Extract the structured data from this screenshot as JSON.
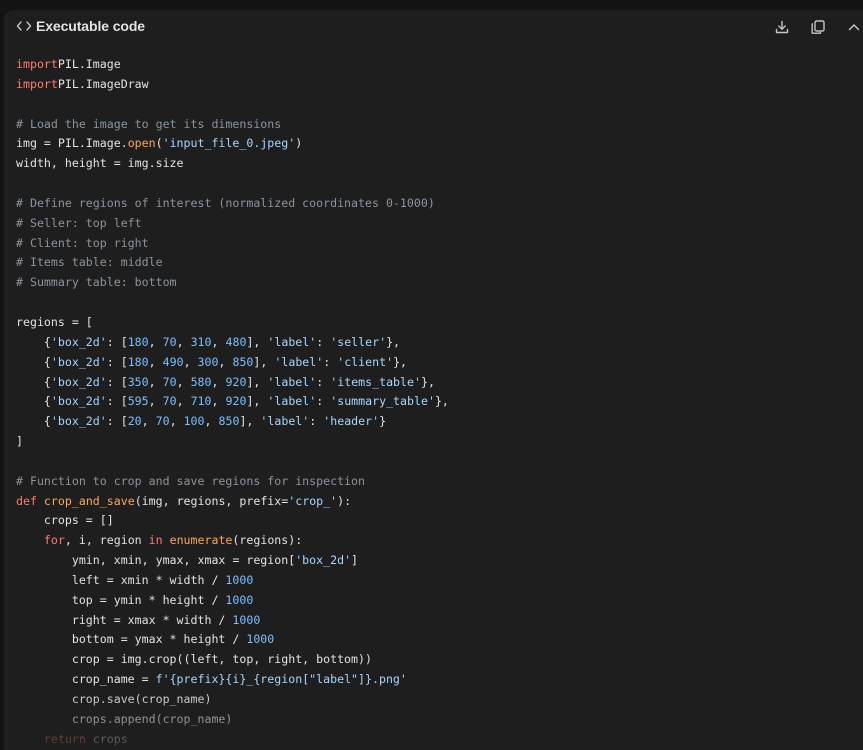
{
  "header": {
    "title": "Executable code",
    "icons": [
      "code-icon",
      "download-icon",
      "copy-icon",
      "chevron-up-icon"
    ]
  },
  "code": {
    "language": "python",
    "lines": [
      [
        [
          "kw",
          "import"
        ],
        [
          "",
          "PIL.Image"
        ]
      ],
      [
        [
          "kw",
          "import"
        ],
        [
          "",
          "PIL.ImageDraw"
        ]
      ],
      [],
      [
        [
          "com",
          "# Load the image to get its dimensions"
        ]
      ],
      [
        [
          "",
          "img = PIL.Image."
        ],
        [
          "fn",
          "open"
        ],
        [
          "",
          "("
        ],
        [
          "str",
          "'input_file_0.jpeg'"
        ],
        [
          "",
          ")"
        ]
      ],
      [
        [
          "",
          "width, height = img.size"
        ]
      ],
      [],
      [
        [
          "com",
          "# Define regions of interest (normalized coordinates 0-1000)"
        ]
      ],
      [
        [
          "com",
          "# Seller: top left"
        ]
      ],
      [
        [
          "com",
          "# Client: top right"
        ]
      ],
      [
        [
          "com",
          "# Items table: middle"
        ]
      ],
      [
        [
          "com",
          "# Summary table: bottom"
        ]
      ],
      [],
      [
        [
          "",
          "regions = ["
        ]
      ],
      [
        [
          "",
          "    {"
        ],
        [
          "str",
          "'box_2d'"
        ],
        [
          "",
          ": ["
        ],
        [
          "num",
          "180"
        ],
        [
          "",
          ", "
        ],
        [
          "num",
          "70"
        ],
        [
          "",
          ", "
        ],
        [
          "num",
          "310"
        ],
        [
          "",
          ", "
        ],
        [
          "num",
          "480"
        ],
        [
          "",
          "], "
        ],
        [
          "str",
          "'label'"
        ],
        [
          "",
          ": "
        ],
        [
          "str",
          "'seller'"
        ],
        [
          "",
          "},"
        ]
      ],
      [
        [
          "",
          "    {"
        ],
        [
          "str",
          "'box_2d'"
        ],
        [
          "",
          ": ["
        ],
        [
          "num",
          "180"
        ],
        [
          "",
          ", "
        ],
        [
          "num",
          "490"
        ],
        [
          "",
          ", "
        ],
        [
          "num",
          "300"
        ],
        [
          "",
          ", "
        ],
        [
          "num",
          "850"
        ],
        [
          "",
          "], "
        ],
        [
          "str",
          "'label'"
        ],
        [
          "",
          ": "
        ],
        [
          "str",
          "'client'"
        ],
        [
          "",
          "},"
        ]
      ],
      [
        [
          "",
          "    {"
        ],
        [
          "str",
          "'box_2d'"
        ],
        [
          "",
          ": ["
        ],
        [
          "num",
          "350"
        ],
        [
          "",
          ", "
        ],
        [
          "num",
          "70"
        ],
        [
          "",
          ", "
        ],
        [
          "num",
          "580"
        ],
        [
          "",
          ", "
        ],
        [
          "num",
          "920"
        ],
        [
          "",
          "], "
        ],
        [
          "str",
          "'label'"
        ],
        [
          "",
          ": "
        ],
        [
          "str",
          "'items_table'"
        ],
        [
          "",
          "},"
        ]
      ],
      [
        [
          "",
          "    {"
        ],
        [
          "str",
          "'box_2d'"
        ],
        [
          "",
          ": ["
        ],
        [
          "num",
          "595"
        ],
        [
          "",
          ", "
        ],
        [
          "num",
          "70"
        ],
        [
          "",
          ", "
        ],
        [
          "num",
          "710"
        ],
        [
          "",
          ", "
        ],
        [
          "num",
          "920"
        ],
        [
          "",
          "], "
        ],
        [
          "str",
          "'label'"
        ],
        [
          "",
          ": "
        ],
        [
          "str",
          "'summary_table'"
        ],
        [
          "",
          "},"
        ]
      ],
      [
        [
          "",
          "    {"
        ],
        [
          "str",
          "'box_2d'"
        ],
        [
          "",
          ": ["
        ],
        [
          "num",
          "20"
        ],
        [
          "",
          ", "
        ],
        [
          "num",
          "70"
        ],
        [
          "",
          ", "
        ],
        [
          "num",
          "100"
        ],
        [
          "",
          ", "
        ],
        [
          "num",
          "850"
        ],
        [
          "",
          "], "
        ],
        [
          "str",
          "'label'"
        ],
        [
          "",
          ": "
        ],
        [
          "str",
          "'header'"
        ],
        [
          "",
          "}"
        ]
      ],
      [
        [
          "",
          "]"
        ]
      ],
      [],
      [
        [
          "com",
          "# Function to crop and save regions for inspection"
        ]
      ],
      [
        [
          "kw",
          "def"
        ],
        [
          "",
          ""
        ],
        [
          "fn",
          " crop_and_save"
        ],
        [
          "",
          "(img, regions, prefix="
        ],
        [
          "str",
          "'crop_'"
        ],
        [
          "",
          "):"
        ]
      ],
      [
        [
          "",
          "    crops = []"
        ]
      ],
      [
        [
          "",
          "    "
        ],
        [
          "kw",
          "for"
        ],
        [
          "",
          ""
        ],
        [
          "",
          ", i, region "
        ],
        [
          "kw",
          "in"
        ],
        [
          "fn",
          " enumerate"
        ],
        [
          "",
          "(regions):"
        ]
      ],
      [
        [
          "",
          "        ymin, xmin, ymax, xmax = region["
        ],
        [
          "str",
          "'box_2d'"
        ],
        [
          "",
          "]"
        ]
      ],
      [
        [
          "",
          "        left = xmin * width / "
        ],
        [
          "num",
          "1000"
        ]
      ],
      [
        [
          "",
          "        top = ymin * height / "
        ],
        [
          "num",
          "1000"
        ]
      ],
      [
        [
          "",
          "        right = xmax * width / "
        ],
        [
          "num",
          "1000"
        ]
      ],
      [
        [
          "",
          "        bottom = ymax * height / "
        ],
        [
          "num",
          "1000"
        ]
      ],
      [
        [
          "",
          "        crop = img.crop((left, top, right, bottom))"
        ]
      ],
      [
        [
          "",
          "        crop_name = "
        ],
        [
          "str",
          "f'{prefix}{i}_{region[\"label\"]}.png'"
        ]
      ],
      [
        [
          "",
          "        crop.save(crop_name)"
        ]
      ],
      [
        [
          "",
          "        crops.append(crop_name)"
        ]
      ],
      [
        [
          "",
          "    "
        ],
        [
          "kw",
          "return"
        ],
        [
          "",
          " crops"
        ]
      ]
    ]
  }
}
